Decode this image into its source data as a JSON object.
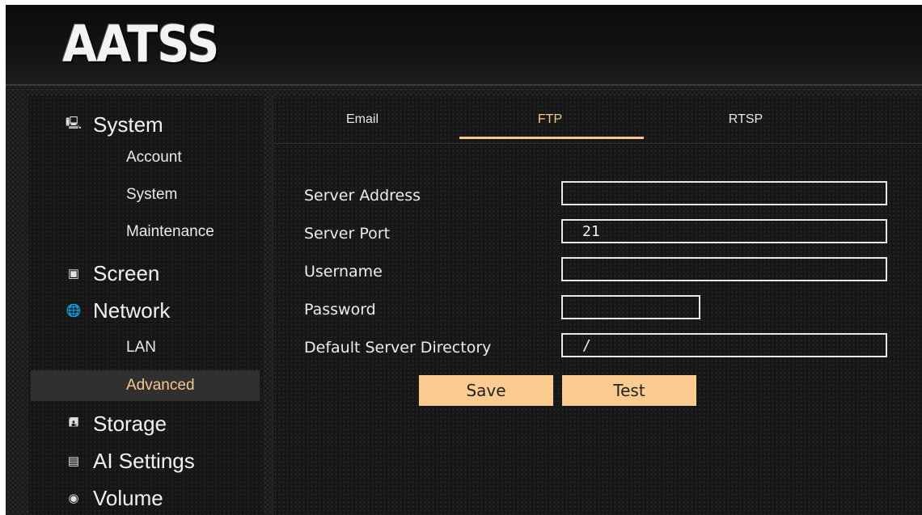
{
  "brand": {
    "logo_text": "AATSS"
  },
  "sidebar": {
    "system": {
      "label": "System",
      "icon": "monitor-icon"
    },
    "system_items": [
      "Account",
      "System",
      "Maintenance"
    ],
    "screen": {
      "label": "Screen",
      "icon": "image-icon"
    },
    "network": {
      "label": "Network",
      "icon": "globe-icon"
    },
    "network_items": [
      "LAN",
      "Advanced"
    ],
    "active_item": "Advanced",
    "storage": {
      "label": "Storage",
      "icon": "floppy-icon"
    },
    "ai_settings": {
      "label": "AI Settings",
      "icon": "chip-icon"
    },
    "volume": {
      "label": "Volume",
      "icon": "speaker-icon"
    }
  },
  "tabs": [
    {
      "label": "Email",
      "active": false
    },
    {
      "label": "FTP",
      "active": true
    },
    {
      "label": "RTSP",
      "active": false
    }
  ],
  "form": {
    "server_address": {
      "label": "Server Address",
      "value": ""
    },
    "server_port": {
      "label": "Server Port",
      "value": "21"
    },
    "username": {
      "label": "Username",
      "value": ""
    },
    "password": {
      "label": "Password",
      "value": ""
    },
    "directory": {
      "label": "Default Server Directory",
      "value": "/"
    }
  },
  "buttons": {
    "save": "Save",
    "test": "Test"
  },
  "colors": {
    "accent": "#f7c88a",
    "button_bg": "#fbcb8f"
  }
}
